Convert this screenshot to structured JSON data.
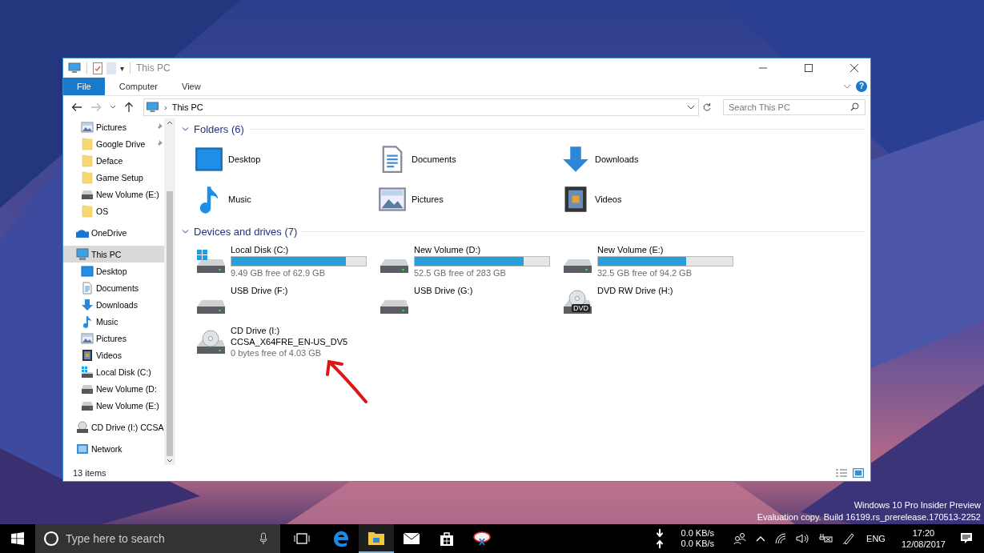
{
  "window": {
    "title": "This PC",
    "qat_more": "▾"
  },
  "ribbon": {
    "tabs": [
      {
        "label": "File",
        "kind": "file",
        "selected": false
      },
      {
        "label": "Computer",
        "kind": "tab",
        "selected": false
      },
      {
        "label": "View",
        "kind": "tab",
        "selected": false
      }
    ],
    "help": "?"
  },
  "address": {
    "separator": "›",
    "path": "This PC",
    "search": {
      "placeholder": "Search This PC"
    }
  },
  "navigation": {
    "quick_access": [
      {
        "label": "Pictures",
        "kind": "pictures",
        "pinned": true,
        "selected": false
      },
      {
        "label": "Google Drive",
        "kind": "folder",
        "pinned": true,
        "selected": false
      },
      {
        "label": "Deface",
        "kind": "folder",
        "pinned": false,
        "selected": false
      },
      {
        "label": "Game Setup",
        "kind": "folder",
        "pinned": false,
        "selected": false
      },
      {
        "label": "New Volume (E:)",
        "kind": "drive",
        "pinned": false,
        "selected": false
      },
      {
        "label": "OS",
        "kind": "folder",
        "pinned": false,
        "selected": false
      }
    ],
    "roots": [
      {
        "label": "OneDrive",
        "kind": "onedrive",
        "selected": false
      },
      {
        "label": "This PC",
        "kind": "pc",
        "selected": true,
        "children": [
          {
            "label": "Desktop",
            "kind": "desktop",
            "selected": false
          },
          {
            "label": "Documents",
            "kind": "documents",
            "selected": false
          },
          {
            "label": "Downloads",
            "kind": "downloads",
            "selected": false
          },
          {
            "label": "Music",
            "kind": "music",
            "selected": false
          },
          {
            "label": "Pictures",
            "kind": "pictures",
            "selected": false
          },
          {
            "label": "Videos",
            "kind": "videos",
            "selected": false
          },
          {
            "label": "Local Disk (C:)",
            "kind": "windrive",
            "selected": false
          },
          {
            "label": "New Volume (D:",
            "kind": "drive",
            "selected": false
          },
          {
            "label": "New Volume (E:)",
            "kind": "drive",
            "selected": false
          }
        ]
      },
      {
        "label": "CD Drive (I:) CCSA",
        "kind": "cd",
        "selected": false
      },
      {
        "label": "Network",
        "kind": "network",
        "selected": false
      }
    ]
  },
  "folders": {
    "heading": "Folders (6)",
    "expanded": true,
    "items": [
      {
        "label": "Desktop",
        "kind": "desktop"
      },
      {
        "label": "Documents",
        "kind": "documents"
      },
      {
        "label": "Downloads",
        "kind": "downloads"
      },
      {
        "label": "Music",
        "kind": "music"
      },
      {
        "label": "Pictures",
        "kind": "pictures"
      },
      {
        "label": "Videos",
        "kind": "videos"
      }
    ]
  },
  "drives": {
    "heading": "Devices and drives (7)",
    "expanded": true,
    "items": [
      {
        "label": "Local Disk (C:)",
        "kind": "windrive",
        "level": 0.85,
        "free": "9.49 GB free of 62.9 GB"
      },
      {
        "label": "New Volume (D:)",
        "kind": "drive",
        "level": 0.81,
        "free": "52.5 GB free of 283 GB"
      },
      {
        "label": "New Volume (E:)",
        "kind": "drive",
        "level": 0.655,
        "free": "32.5 GB free of 94.2 GB"
      },
      {
        "label": "USB Drive (F:)",
        "kind": "usb"
      },
      {
        "label": "USB Drive (G:)",
        "kind": "usb"
      },
      {
        "label": "DVD RW Drive (H:)",
        "kind": "dvd",
        "disc_label": "DVD"
      },
      {
        "label": "CD Drive (I:)",
        "kind": "cd",
        "volume": "CCSA_X64FRE_EN-US_DV5",
        "free": "0 bytes free of 4.03 GB"
      }
    ]
  },
  "status_bar": {
    "items": "13 items"
  },
  "desktop": {
    "watermark": [
      "Windows 10 Pro Insider Preview",
      "Evaluation copy. Build 16199.rs_prerelease.170513-2252"
    ]
  },
  "taskbar": {
    "search": {
      "placeholder": "Type here to search"
    },
    "apps": [
      {
        "kind": "edge",
        "active": false
      },
      {
        "kind": "explorer",
        "active": true
      },
      {
        "kind": "mail",
        "active": false
      },
      {
        "kind": "store",
        "active": false
      },
      {
        "kind": "snip",
        "active": false
      }
    ],
    "net_speed": [
      "0.0 KB/s",
      "0.0 KB/s"
    ],
    "language": "ENG",
    "time": "17:20",
    "date": "12/08/2017"
  }
}
